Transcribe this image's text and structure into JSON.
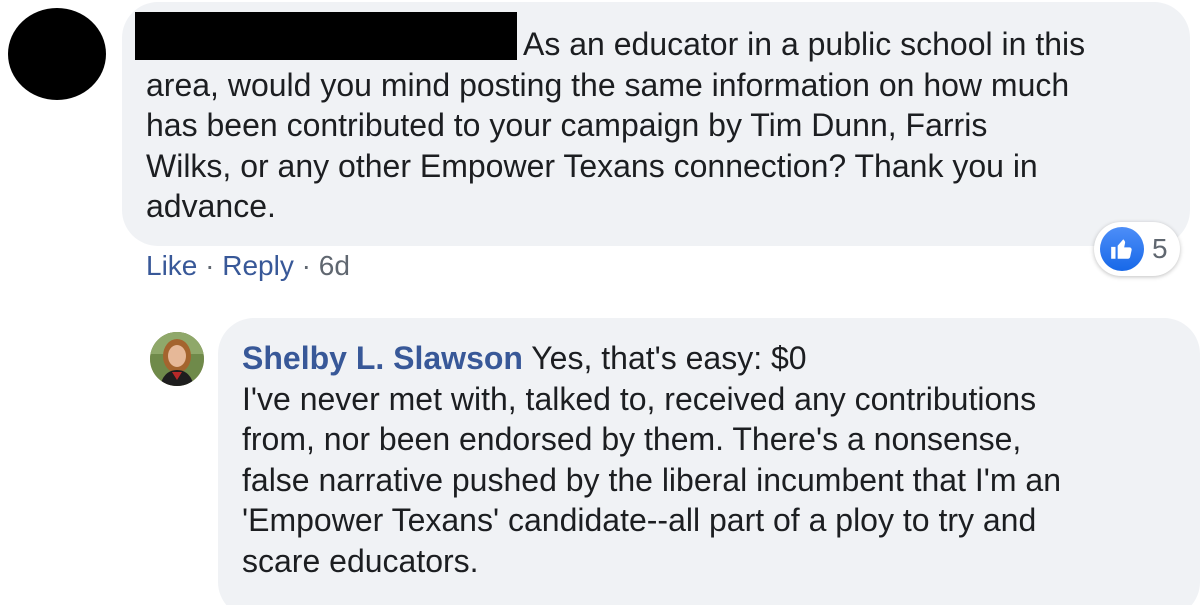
{
  "comment_1": {
    "text": "As an educator in a public school in this area, would you mind posting the same information on how much has been contributed to your campaign by Tim Dunn, Farris Wilks, or any other Empower Texans connection? Thank you in advance.",
    "line1": "As an educator in a public school in this",
    "lines": [
      "area, would you mind posting the same information on how much",
      "has been contributed to your campaign by Tim Dunn, Farris",
      "Wilks, or any other Empower Texans connection? Thank you in",
      "advance."
    ],
    "actions": {
      "like_label": "Like",
      "reply_label": "Reply",
      "separator": "·",
      "timestamp": "6d"
    },
    "reactions": {
      "icon": "thumbs-up-icon",
      "count": "5",
      "color": "#1877f2"
    }
  },
  "comment_2": {
    "author": "Shelby L. Slawson",
    "first_line": "Yes, that's easy: $0",
    "lines": [
      "I've never met with, talked to, received any contributions",
      "from, nor been endorsed by them. There's a nonsense,",
      "false narrative pushed by the liberal incumbent that I'm an",
      "'Empower Texans' candidate--all part of a ploy to try and",
      "scare educators."
    ]
  },
  "colors": {
    "bubble_bg": "#f0f2f5",
    "link": "#385898",
    "text": "#1c1e21",
    "meta": "#606770"
  }
}
